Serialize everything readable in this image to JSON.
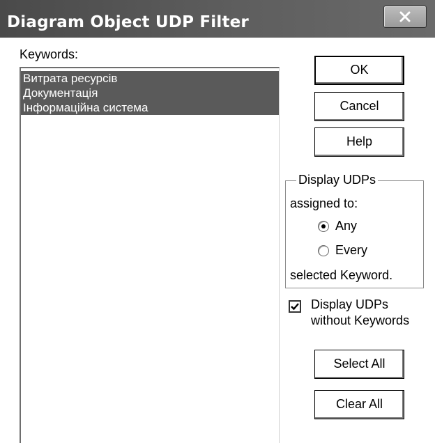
{
  "window": {
    "title": "Diagram Object UDP Filter",
    "close_symbol": "x"
  },
  "keywords": {
    "label": "Keywords:",
    "items": [
      "Витрата ресурсів",
      "Документація",
      "Інформаційна система"
    ]
  },
  "buttons": {
    "ok": "OK",
    "cancel": "Cancel",
    "help": "Help",
    "select_all": "Select All",
    "clear_all": "Clear All"
  },
  "display_group": {
    "title": "Display UDPs",
    "line2": "assigned to:",
    "option_any": "Any",
    "option_every": "Every",
    "footer": "selected Keyword.",
    "selected": "Any"
  },
  "without_keywords": {
    "line1": "Display UDPs",
    "line2": "without Keywords",
    "checked": true
  },
  "colors": {
    "title_bar": "#4a4a4a",
    "selection": "#5a5a5a"
  }
}
